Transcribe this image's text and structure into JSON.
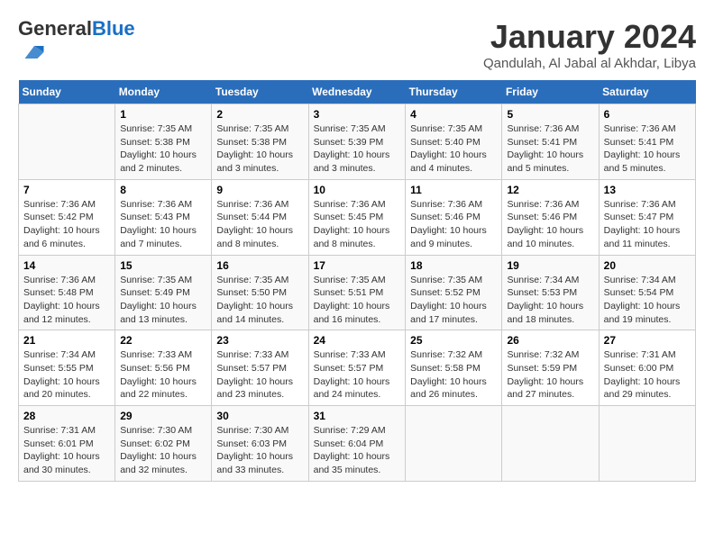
{
  "header": {
    "logo_general": "General",
    "logo_blue": "Blue",
    "month_title": "January 2024",
    "location": "Qandulah, Al Jabal al Akhdar, Libya"
  },
  "days_of_week": [
    "Sunday",
    "Monday",
    "Tuesday",
    "Wednesday",
    "Thursday",
    "Friday",
    "Saturday"
  ],
  "weeks": [
    [
      {
        "day": "",
        "info": ""
      },
      {
        "day": "1",
        "info": "Sunrise: 7:35 AM\nSunset: 5:38 PM\nDaylight: 10 hours\nand 2 minutes."
      },
      {
        "day": "2",
        "info": "Sunrise: 7:35 AM\nSunset: 5:38 PM\nDaylight: 10 hours\nand 3 minutes."
      },
      {
        "day": "3",
        "info": "Sunrise: 7:35 AM\nSunset: 5:39 PM\nDaylight: 10 hours\nand 3 minutes."
      },
      {
        "day": "4",
        "info": "Sunrise: 7:35 AM\nSunset: 5:40 PM\nDaylight: 10 hours\nand 4 minutes."
      },
      {
        "day": "5",
        "info": "Sunrise: 7:36 AM\nSunset: 5:41 PM\nDaylight: 10 hours\nand 5 minutes."
      },
      {
        "day": "6",
        "info": "Sunrise: 7:36 AM\nSunset: 5:41 PM\nDaylight: 10 hours\nand 5 minutes."
      }
    ],
    [
      {
        "day": "7",
        "info": "Sunrise: 7:36 AM\nSunset: 5:42 PM\nDaylight: 10 hours\nand 6 minutes."
      },
      {
        "day": "8",
        "info": "Sunrise: 7:36 AM\nSunset: 5:43 PM\nDaylight: 10 hours\nand 7 minutes."
      },
      {
        "day": "9",
        "info": "Sunrise: 7:36 AM\nSunset: 5:44 PM\nDaylight: 10 hours\nand 8 minutes."
      },
      {
        "day": "10",
        "info": "Sunrise: 7:36 AM\nSunset: 5:45 PM\nDaylight: 10 hours\nand 8 minutes."
      },
      {
        "day": "11",
        "info": "Sunrise: 7:36 AM\nSunset: 5:46 PM\nDaylight: 10 hours\nand 9 minutes."
      },
      {
        "day": "12",
        "info": "Sunrise: 7:36 AM\nSunset: 5:46 PM\nDaylight: 10 hours\nand 10 minutes."
      },
      {
        "day": "13",
        "info": "Sunrise: 7:36 AM\nSunset: 5:47 PM\nDaylight: 10 hours\nand 11 minutes."
      }
    ],
    [
      {
        "day": "14",
        "info": "Sunrise: 7:36 AM\nSunset: 5:48 PM\nDaylight: 10 hours\nand 12 minutes."
      },
      {
        "day": "15",
        "info": "Sunrise: 7:35 AM\nSunset: 5:49 PM\nDaylight: 10 hours\nand 13 minutes."
      },
      {
        "day": "16",
        "info": "Sunrise: 7:35 AM\nSunset: 5:50 PM\nDaylight: 10 hours\nand 14 minutes."
      },
      {
        "day": "17",
        "info": "Sunrise: 7:35 AM\nSunset: 5:51 PM\nDaylight: 10 hours\nand 16 minutes."
      },
      {
        "day": "18",
        "info": "Sunrise: 7:35 AM\nSunset: 5:52 PM\nDaylight: 10 hours\nand 17 minutes."
      },
      {
        "day": "19",
        "info": "Sunrise: 7:34 AM\nSunset: 5:53 PM\nDaylight: 10 hours\nand 18 minutes."
      },
      {
        "day": "20",
        "info": "Sunrise: 7:34 AM\nSunset: 5:54 PM\nDaylight: 10 hours\nand 19 minutes."
      }
    ],
    [
      {
        "day": "21",
        "info": "Sunrise: 7:34 AM\nSunset: 5:55 PM\nDaylight: 10 hours\nand 20 minutes."
      },
      {
        "day": "22",
        "info": "Sunrise: 7:33 AM\nSunset: 5:56 PM\nDaylight: 10 hours\nand 22 minutes."
      },
      {
        "day": "23",
        "info": "Sunrise: 7:33 AM\nSunset: 5:57 PM\nDaylight: 10 hours\nand 23 minutes."
      },
      {
        "day": "24",
        "info": "Sunrise: 7:33 AM\nSunset: 5:57 PM\nDaylight: 10 hours\nand 24 minutes."
      },
      {
        "day": "25",
        "info": "Sunrise: 7:32 AM\nSunset: 5:58 PM\nDaylight: 10 hours\nand 26 minutes."
      },
      {
        "day": "26",
        "info": "Sunrise: 7:32 AM\nSunset: 5:59 PM\nDaylight: 10 hours\nand 27 minutes."
      },
      {
        "day": "27",
        "info": "Sunrise: 7:31 AM\nSunset: 6:00 PM\nDaylight: 10 hours\nand 29 minutes."
      }
    ],
    [
      {
        "day": "28",
        "info": "Sunrise: 7:31 AM\nSunset: 6:01 PM\nDaylight: 10 hours\nand 30 minutes."
      },
      {
        "day": "29",
        "info": "Sunrise: 7:30 AM\nSunset: 6:02 PM\nDaylight: 10 hours\nand 32 minutes."
      },
      {
        "day": "30",
        "info": "Sunrise: 7:30 AM\nSunset: 6:03 PM\nDaylight: 10 hours\nand 33 minutes."
      },
      {
        "day": "31",
        "info": "Sunrise: 7:29 AM\nSunset: 6:04 PM\nDaylight: 10 hours\nand 35 minutes."
      },
      {
        "day": "",
        "info": ""
      },
      {
        "day": "",
        "info": ""
      },
      {
        "day": "",
        "info": ""
      }
    ]
  ]
}
